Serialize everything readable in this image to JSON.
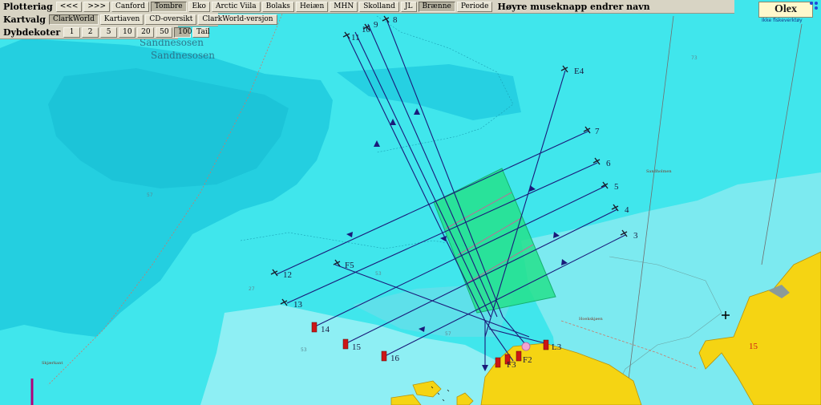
{
  "toolbar": {
    "row1_label": "Plotteriag",
    "row1_buttons": [
      "<<<",
      ">>>",
      "Canford",
      "Tombre",
      "Eko",
      "Arctic Viila",
      "Bolaks",
      "Heiæn",
      "MHN",
      "Skolland",
      "JL",
      "Brænne",
      "Periode"
    ],
    "row1_right_text": "Høyre museknapp endrer navn",
    "row1_active": [
      3,
      11
    ],
    "row2_label": "Kartvalg",
    "row2_buttons": [
      "ClarkWorld",
      "Kartiaven",
      "CD-oversikt",
      "ClarkWorld-versjon"
    ],
    "row2_active": [
      0
    ],
    "row3_label": "Dybdekoter",
    "row3_buttons": [
      "1",
      "2",
      "5",
      "10",
      "20",
      "50",
      "100",
      "Tail"
    ],
    "row3_active": [
      6
    ]
  },
  "logo": {
    "text": "Olex",
    "subtitle": "Ikke fiskeverktøy"
  },
  "place_names": [
    "Sandnesosen",
    "Sandnesosen"
  ],
  "colors": {
    "water_deep": "#19c8dc",
    "water_mid": "#40e6ec",
    "water_shallow": "#86eef2",
    "land": "#f5d413",
    "highlight_polygon": "#26e08c",
    "track_line": "#1a1a7a",
    "marker_red": "#cc1616"
  },
  "map": {
    "marker_labels": [
      "11",
      "10",
      "9",
      "8",
      "E4",
      "7",
      "6",
      "5",
      "4",
      "3",
      "12",
      "13",
      "14",
      "15",
      "16",
      "F5",
      "F2",
      "F3",
      "L3",
      "15"
    ],
    "depth_labels": [
      "57",
      "53",
      "73",
      "57",
      "53",
      "27"
    ],
    "chart_notes": [
      "Skjærkant",
      "Sandholmen",
      "Hoekskjøen"
    ]
  }
}
